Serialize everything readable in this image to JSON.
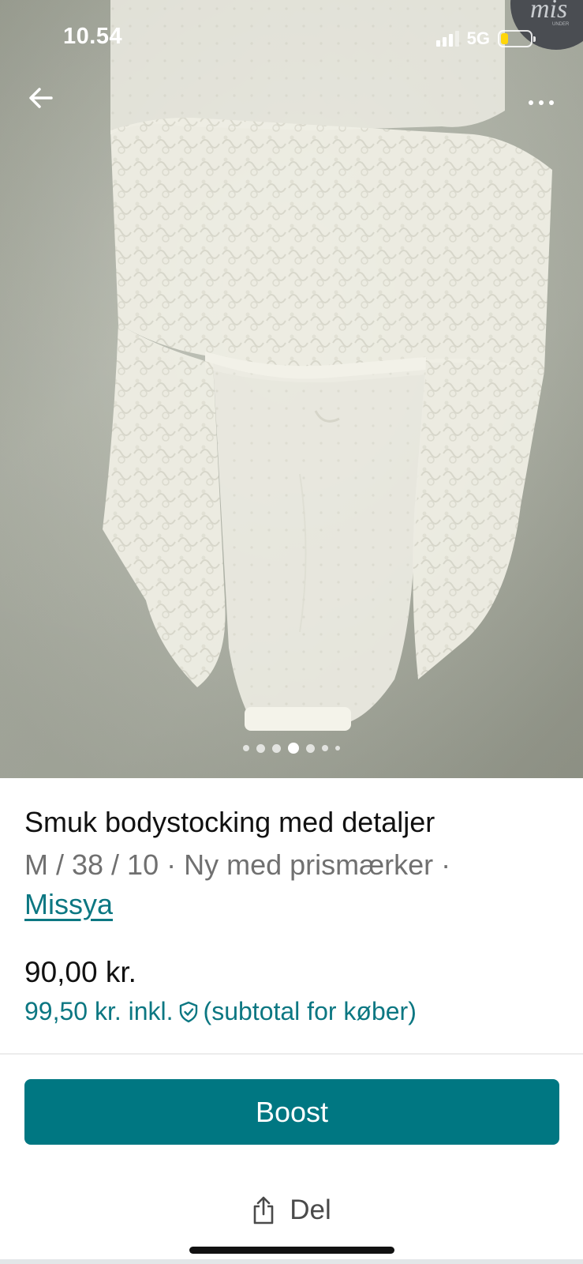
{
  "status_bar": {
    "time": "10.54",
    "network": "5G",
    "battery_color": "#ffd60a"
  },
  "nav": {
    "back_icon": "arrow-left-icon",
    "more_icon": "more-horizontal-icon"
  },
  "photo": {
    "tag_text": "mis",
    "tag_subtext": "UNDER",
    "carousel": {
      "count": 7,
      "active_index": 3
    }
  },
  "listing": {
    "title": "Smuk bodystocking med detaljer",
    "meta": "M / 38 / 10 · Ny med prismærker ·",
    "brand": "Missya",
    "price": "90,00 kr.",
    "price_incl_prefix": "99,50 kr. inkl.",
    "price_incl_suffix": "(subtotal for køber)",
    "protection_icon": "shield-check-icon"
  },
  "actions": {
    "boost_label": "Boost",
    "share_label": "Del",
    "share_icon": "share-icon"
  },
  "colors": {
    "accent": "#007782",
    "link": "#0c7782"
  }
}
